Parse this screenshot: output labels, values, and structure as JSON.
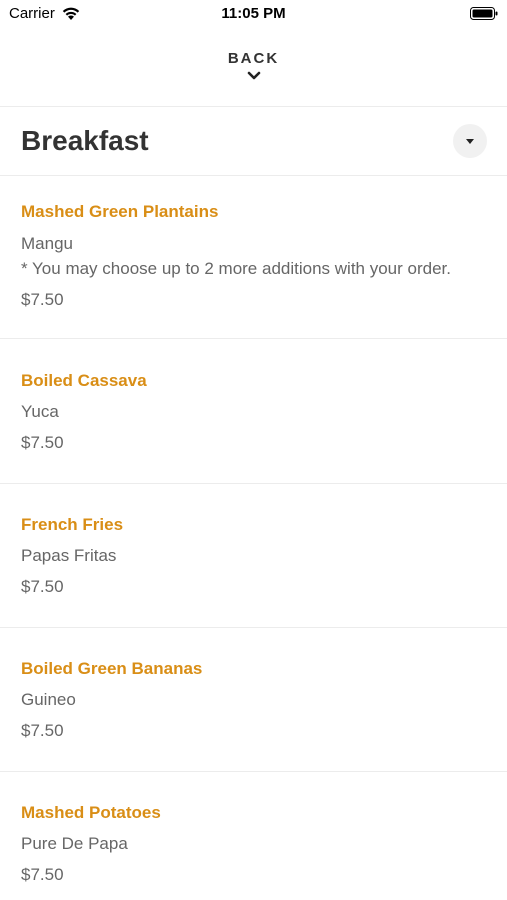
{
  "status_bar": {
    "carrier": "Carrier",
    "time": "11:05 PM"
  },
  "header": {
    "back_label": "BACK"
  },
  "category": {
    "title": "Breakfast"
  },
  "menu_items": [
    {
      "name": "Mashed Green Plantains",
      "description": "Mangu",
      "note": "* You may choose up to 2 more additions with your order.",
      "price": "$7.50"
    },
    {
      "name": "Boiled Cassava",
      "description": "Yuca",
      "price": "$7.50"
    },
    {
      "name": "French Fries",
      "description": "Papas Fritas",
      "price": "$7.50"
    },
    {
      "name": "Boiled Green Bananas",
      "description": "Guineo",
      "price": "$7.50"
    },
    {
      "name": "Mashed Potatoes",
      "description": "Pure De Papa",
      "price": "$7.50"
    }
  ],
  "colors": {
    "accent": "#d98e16",
    "text_primary": "#333333",
    "text_secondary": "#666666",
    "divider": "#ececec"
  }
}
